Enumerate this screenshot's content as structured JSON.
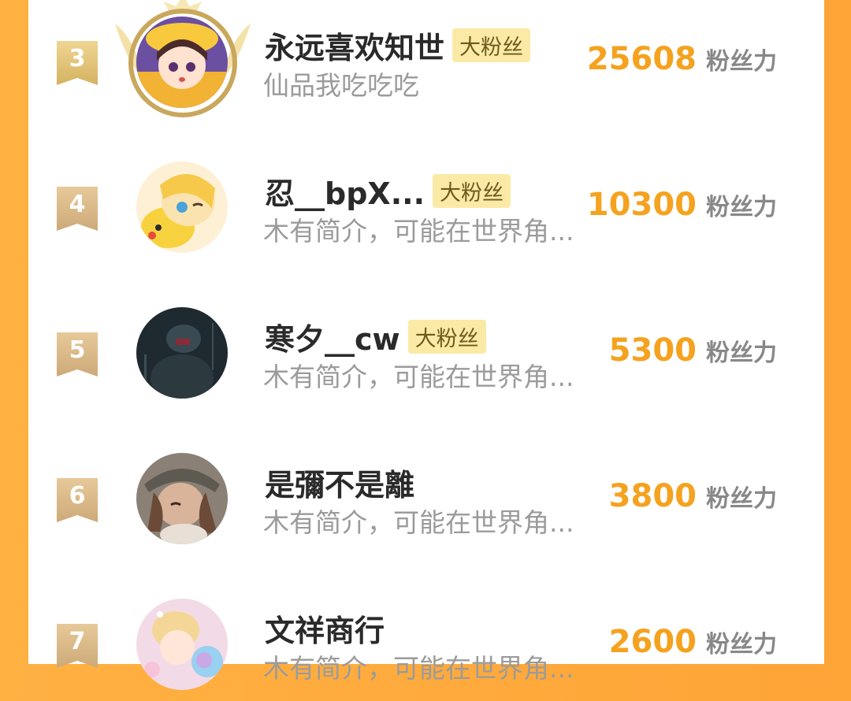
{
  "fan_ranking": {
    "unit_label": "粉丝力",
    "entries": [
      {
        "rank": "3",
        "name": "永远喜欢知世",
        "badge": "大粉丝",
        "bio": "仙品我吃吃吃",
        "score": "25608",
        "avatar_icon": "anime-girl-yellow-hat-avatar",
        "has_frame": true
      },
      {
        "rank": "4",
        "name": "忍__bpX...",
        "badge": "大粉丝",
        "bio": "木有简介，可能在世界角...",
        "score": "10300",
        "avatar_icon": "anime-girl-pikachu-avatar"
      },
      {
        "rank": "5",
        "name": "寒夕__cw",
        "badge": "大粉丝",
        "bio": "木有简介，可能在世界角...",
        "score": "5300",
        "avatar_icon": "dark-figure-avatar"
      },
      {
        "rank": "6",
        "name": "是彌不是離",
        "badge": "",
        "bio": "木有简介，可能在世界角...",
        "score": "3800",
        "avatar_icon": "anime-character-cap-avatar"
      },
      {
        "rank": "7",
        "name": "文祥商行",
        "badge": "",
        "bio": "木有简介，可能在世界角...",
        "score": "2600",
        "avatar_icon": "anime-pastel-avatar"
      }
    ]
  },
  "colors": {
    "accent_orange": "#f5a21f",
    "badge_bg": "#fbeaa6",
    "rank_tag": "#cda978"
  }
}
